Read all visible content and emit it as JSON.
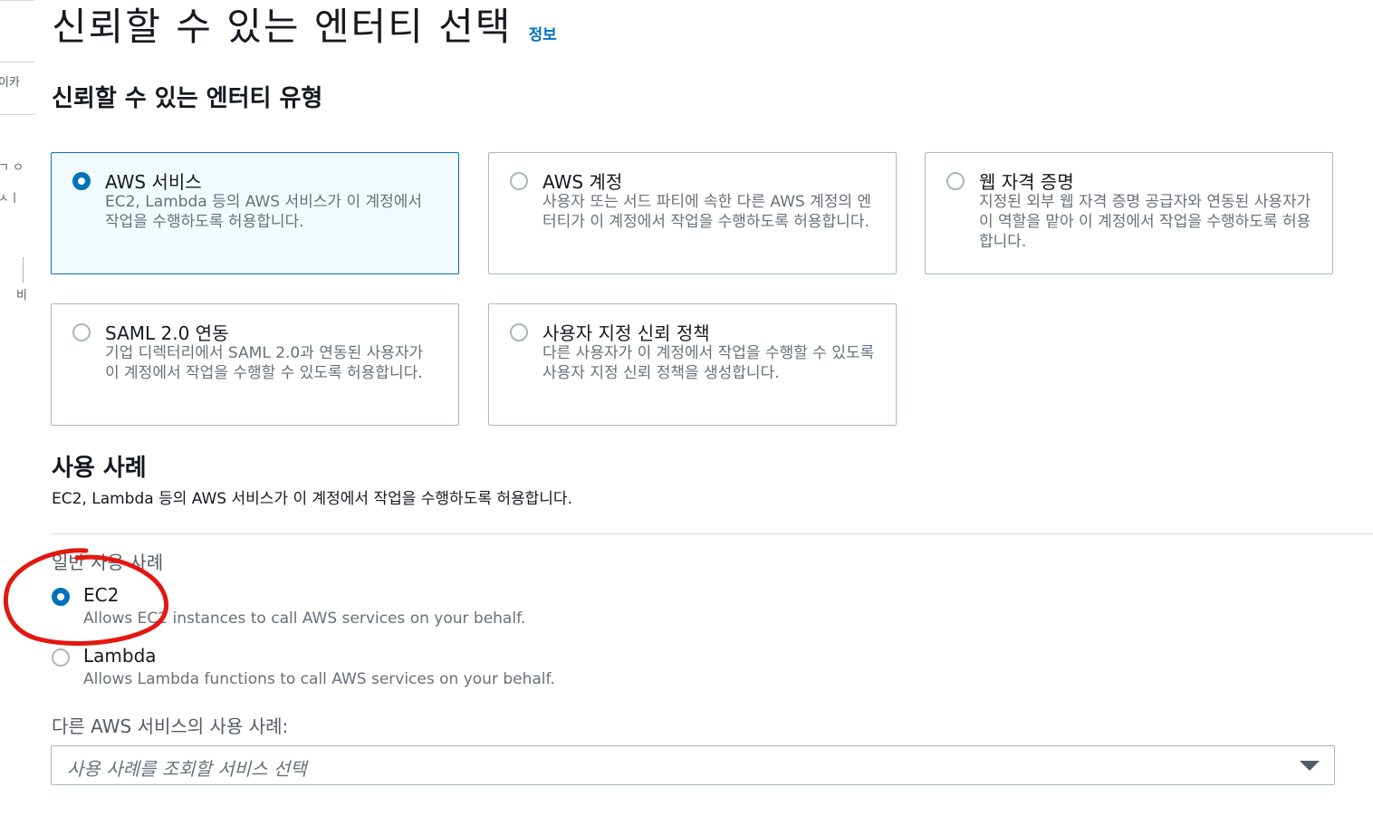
{
  "left_nav": {
    "fragments": [
      "이카",
      "ㄱ ㅇ",
      "ㅅㅣ",
      "비"
    ]
  },
  "header": {
    "title": "신뢰할 수 있는 엔터티 선택",
    "info_link": "정보"
  },
  "entity_types": {
    "section_title": "신뢰할 수 있는 엔터티 유형",
    "tiles": [
      {
        "title": "AWS 서비스",
        "description": "EC2, Lambda 등의 AWS 서비스가 이 계정에서 작업을 수행하도록 허용합니다.",
        "selected": true
      },
      {
        "title": "AWS 계정",
        "description": "사용자 또는 서드 파티에 속한 다른 AWS 계정의 엔터티가 이 계정에서 작업을 수행하도록 허용합니다.",
        "selected": false
      },
      {
        "title": "웹 자격 증명",
        "description": "지정된 외부 웹 자격 증명 공급자와 연동된 사용자가 이 역할을 맡아 이 계정에서 작업을 수행하도록 허용합니다.",
        "selected": false
      },
      {
        "title": "SAML 2.0 연동",
        "description": "기업 디렉터리에서 SAML 2.0과 연동된 사용자가 이 계정에서 작업을 수행할 수 있도록 허용합니다.",
        "selected": false
      },
      {
        "title": "사용자 지정 신뢰 정책",
        "description": "다른 사용자가 이 계정에서 작업을 수행할 수 있도록 사용자 지정 신뢰 정책을 생성합니다.",
        "selected": false
      }
    ]
  },
  "use_case": {
    "section_title": "사용 사례",
    "description": "EC2, Lambda 등의 AWS 서비스가 이 계정에서 작업을 수행하도록 허용합니다.",
    "group_label": "일반 사용 사례",
    "options": [
      {
        "title": "EC2",
        "description": "Allows EC2 instances to call AWS services on your behalf.",
        "selected": true
      },
      {
        "title": "Lambda",
        "description": "Allows Lambda functions to call AWS services on your behalf.",
        "selected": false
      }
    ],
    "other_label": "다른 AWS 서비스의 사용 사례:",
    "select_placeholder": "사용 사례를 조회할 서비스 선택"
  },
  "colors": {
    "accent": "#0073bb",
    "annotation": "#e3170f"
  }
}
